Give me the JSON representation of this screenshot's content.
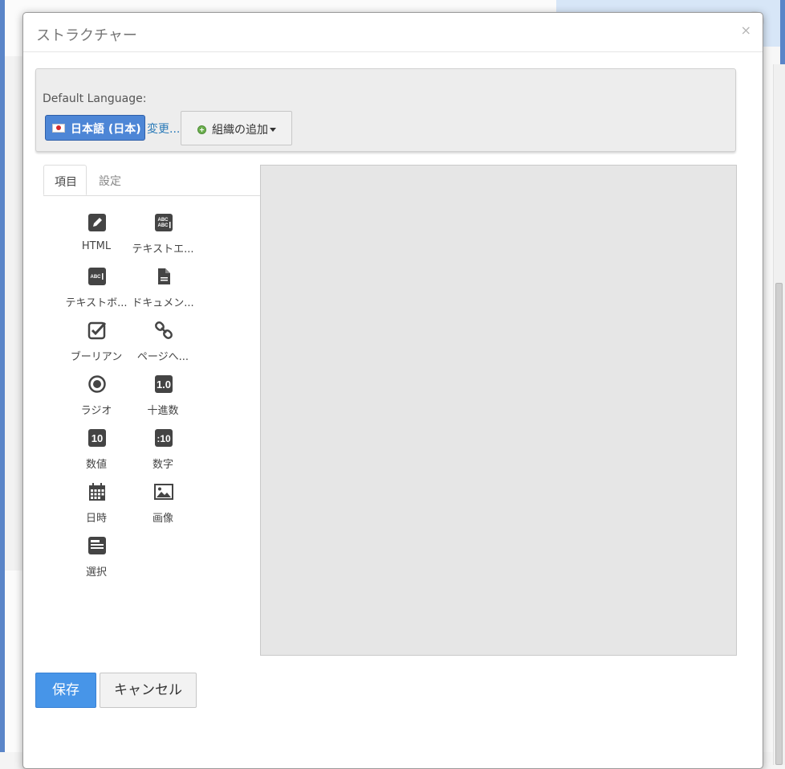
{
  "modal": {
    "title": "ストラクチャー",
    "close_glyph": "×"
  },
  "language": {
    "label": "Default Language:",
    "current": "日本語 (日本)",
    "flag_icon": "japan-flag-icon",
    "change_link": "変更...",
    "add_org_label": "組織の追加",
    "add_org_icon": "add-circle-icon"
  },
  "tabs": [
    {
      "label": "項目",
      "active": true
    },
    {
      "label": "設定",
      "active": false
    }
  ],
  "palette": [
    {
      "label": "HTML",
      "icon": "pencil-icon"
    },
    {
      "label": "テキストエ...",
      "icon": "text-area-icon"
    },
    {
      "label": "テキストボ...",
      "icon": "text-box-icon"
    },
    {
      "label": "ドキュメン...",
      "icon": "document-icon"
    },
    {
      "label": "ブーリアン",
      "icon": "checkbox-icon"
    },
    {
      "label": "ページへ...",
      "icon": "link-icon"
    },
    {
      "label": "ラジオ",
      "icon": "radio-icon"
    },
    {
      "label": "十進数",
      "icon": "decimal-icon",
      "glyph": "1.0"
    },
    {
      "label": "数値",
      "icon": "number-icon",
      "glyph": "10"
    },
    {
      "label": "数字",
      "icon": "integer-icon",
      "glyph": ":10"
    },
    {
      "label": "日時",
      "icon": "calendar-icon"
    },
    {
      "label": "画像",
      "icon": "image-icon"
    },
    {
      "label": "選択",
      "icon": "select-icon"
    }
  ],
  "footer": {
    "save_label": "保存",
    "cancel_label": "キャンセル"
  },
  "colors": {
    "primary": "#4795e8",
    "lang_button": "#4d86d6",
    "link": "#2a7ab8",
    "icon": "#444444"
  }
}
